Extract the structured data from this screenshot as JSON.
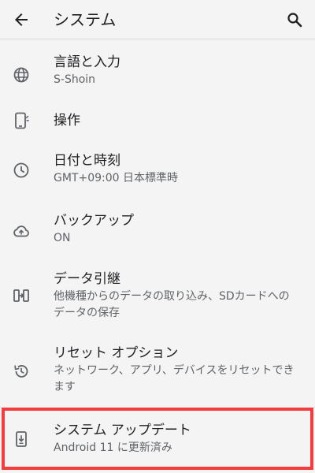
{
  "appbar": {
    "back_icon": "arrow-back-icon",
    "title": "システム",
    "search_icon": "search-icon"
  },
  "items": [
    {
      "icon": "globe-icon",
      "label": "言語と入力",
      "summary": "S-Shoin"
    },
    {
      "icon": "gesture-phone-icon",
      "label": "操作",
      "summary": ""
    },
    {
      "icon": "clock-icon",
      "label": "日付と時刻",
      "summary": "GMT+09:00 日本標準時"
    },
    {
      "icon": "cloud-upload-icon",
      "label": "バックアップ",
      "summary": "ON"
    },
    {
      "icon": "data-transfer-icon",
      "label": "データ引継",
      "summary": "他機種からのデータの取り込み、SDカードへのデータの保存"
    },
    {
      "icon": "restore-icon",
      "label": "リセット オプション",
      "summary": "ネットワーク、アプリ、デバイスをリセットできます"
    },
    {
      "icon": "system-update-icon",
      "label": "システム アップデート",
      "summary": "Android 11 に更新済み"
    }
  ],
  "colors": {
    "background": "#f4f4f4",
    "text_primary": "#202124",
    "text_secondary": "#5f6368",
    "icon": "#5f6368",
    "highlight": "#f33c3c"
  }
}
